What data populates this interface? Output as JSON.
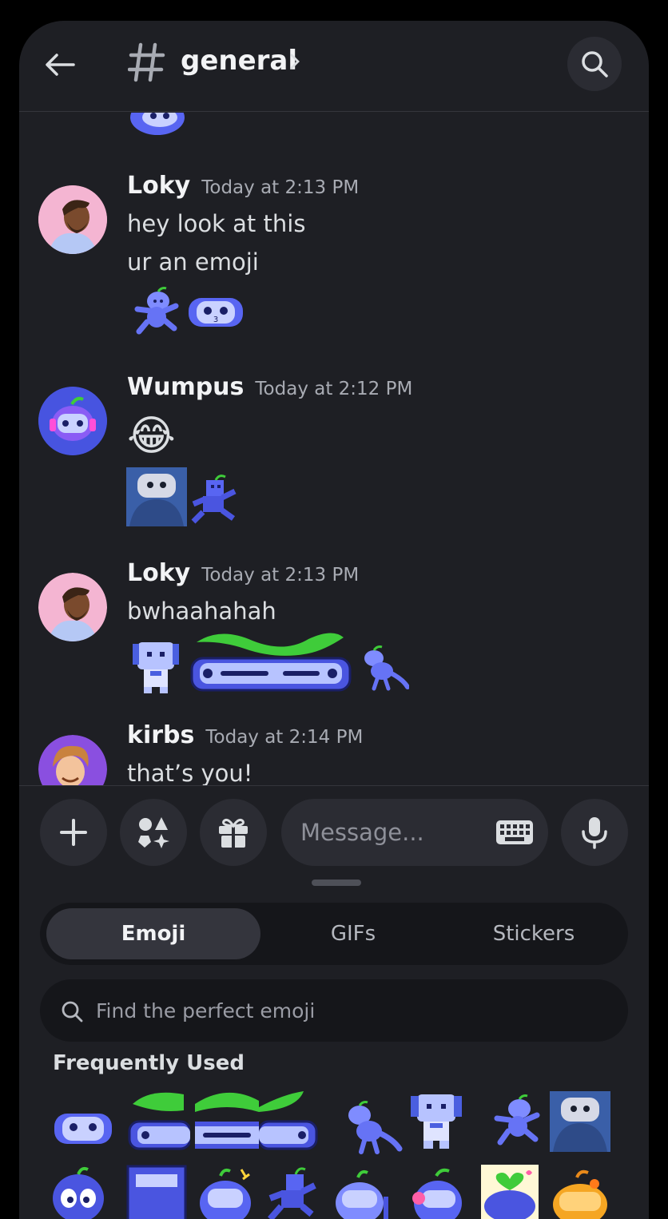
{
  "header": {
    "channel_name": "general"
  },
  "messages": [
    {
      "author": "Loky",
      "time": "Today at 2:13 PM",
      "lines": [
        "hey look at this",
        "ur an emoji"
      ]
    },
    {
      "author": "Wumpus",
      "time": "Today at 2:12 PM",
      "lines": [
        "😂"
      ]
    },
    {
      "author": "Loky",
      "time": "Today at 2:13 PM",
      "lines": [
        "bwhaahahah"
      ]
    },
    {
      "author": "kirbs",
      "time": "Today at 2:14 PM",
      "lines": [
        "that’s you!"
      ]
    }
  ],
  "composer": {
    "placeholder": "Message..."
  },
  "picker": {
    "tabs": [
      "Emoji",
      "GIFs",
      "Stickers"
    ],
    "active_tab": "Emoji",
    "search_placeholder": "Find the perfect emoji",
    "section_title": "Frequently Used"
  },
  "colors": {
    "background": "#1e1f24",
    "surface": "#2b2c33",
    "wumpus_blue": "#5865f2",
    "leaf_green": "#3fcc3a"
  }
}
